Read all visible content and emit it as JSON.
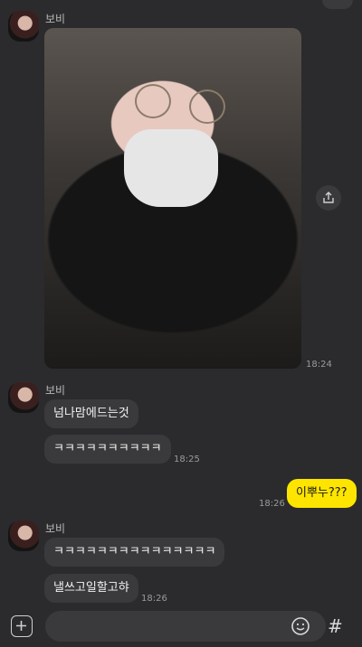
{
  "chat": {
    "sender_name": "보비",
    "messages": [
      {
        "time": "18:24"
      },
      {
        "text": "넘나맘에드는것"
      },
      {
        "text": "ㅋㅋㅋㅋㅋㅋㅋㅋㅋㅋ",
        "time": "18:25"
      },
      {
        "text": "이뿌누???",
        "time": "18:26"
      },
      {
        "text": "ㅋㅋㅋㅋㅋㅋㅋㅋㅋㅋㅋㅋㅋㅋㅋ"
      },
      {
        "text": "낼쓰고일할고햐",
        "time": "18:26"
      }
    ]
  },
  "composer": {
    "hash_symbol": "#",
    "icons": [
      "plus-icon",
      "emoji-icon",
      "hash-icon"
    ]
  }
}
